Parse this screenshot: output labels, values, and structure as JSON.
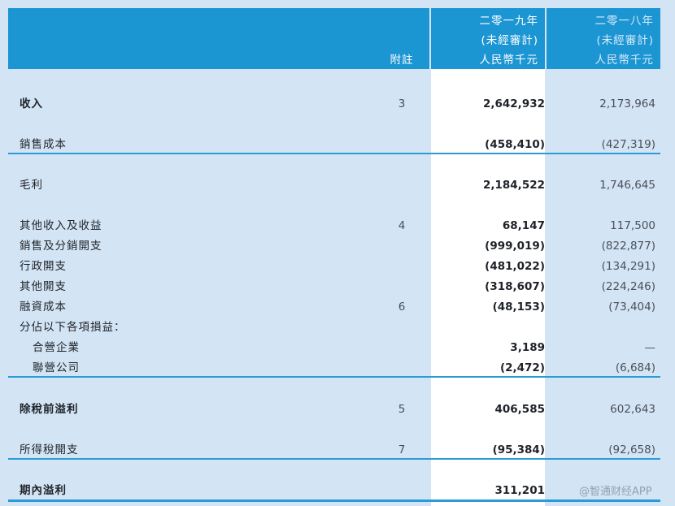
{
  "header": {
    "note_label": "附註",
    "col_2019": {
      "year": "二零一九年",
      "audit": "(未經審計)",
      "unit": "人民幣千元"
    },
    "col_2018": {
      "year": "二零一八年",
      "audit": "(未經審計)",
      "unit": "人民幣千元"
    }
  },
  "rows": [
    {
      "label": "收入",
      "note": "3",
      "v2019": "2,642,932",
      "v2018": "2,173,964"
    },
    {
      "label": "銷售成本",
      "note": "",
      "v2019": "(458,410)",
      "v2018": "(427,319)"
    },
    {
      "label": "毛利",
      "note": "",
      "v2019": "2,184,522",
      "v2018": "1,746,645"
    },
    {
      "label": "其他收入及收益",
      "note": "4",
      "v2019": "68,147",
      "v2018": "117,500"
    },
    {
      "label": "銷售及分銷開支",
      "note": "",
      "v2019": "(999,019)",
      "v2018": "(822,877)"
    },
    {
      "label": "行政開支",
      "note": "",
      "v2019": "(481,022)",
      "v2018": "(134,291)"
    },
    {
      "label": "其他開支",
      "note": "",
      "v2019": "(318,607)",
      "v2018": "(224,246)"
    },
    {
      "label": "融資成本",
      "note": "6",
      "v2019": "(48,153)",
      "v2018": "(73,404)"
    },
    {
      "label": "分佔以下各項損益：",
      "note": "",
      "v2019": "",
      "v2018": ""
    },
    {
      "label": "合營企業",
      "note": "",
      "v2019": "3,189",
      "v2018": "—"
    },
    {
      "label": "聯營公司",
      "note": "",
      "v2019": "(2,472)",
      "v2018": "(6,684)"
    },
    {
      "label": "除稅前溢利",
      "note": "5",
      "v2019": "406,585",
      "v2018": "602,643"
    },
    {
      "label": "所得稅開支",
      "note": "7",
      "v2019": "(95,384)",
      "v2018": "(92,658)"
    },
    {
      "label": "期內溢利",
      "note": "",
      "v2019": "311,201",
      "v2018": ""
    }
  ],
  "watermark": "@智通财经APP"
}
